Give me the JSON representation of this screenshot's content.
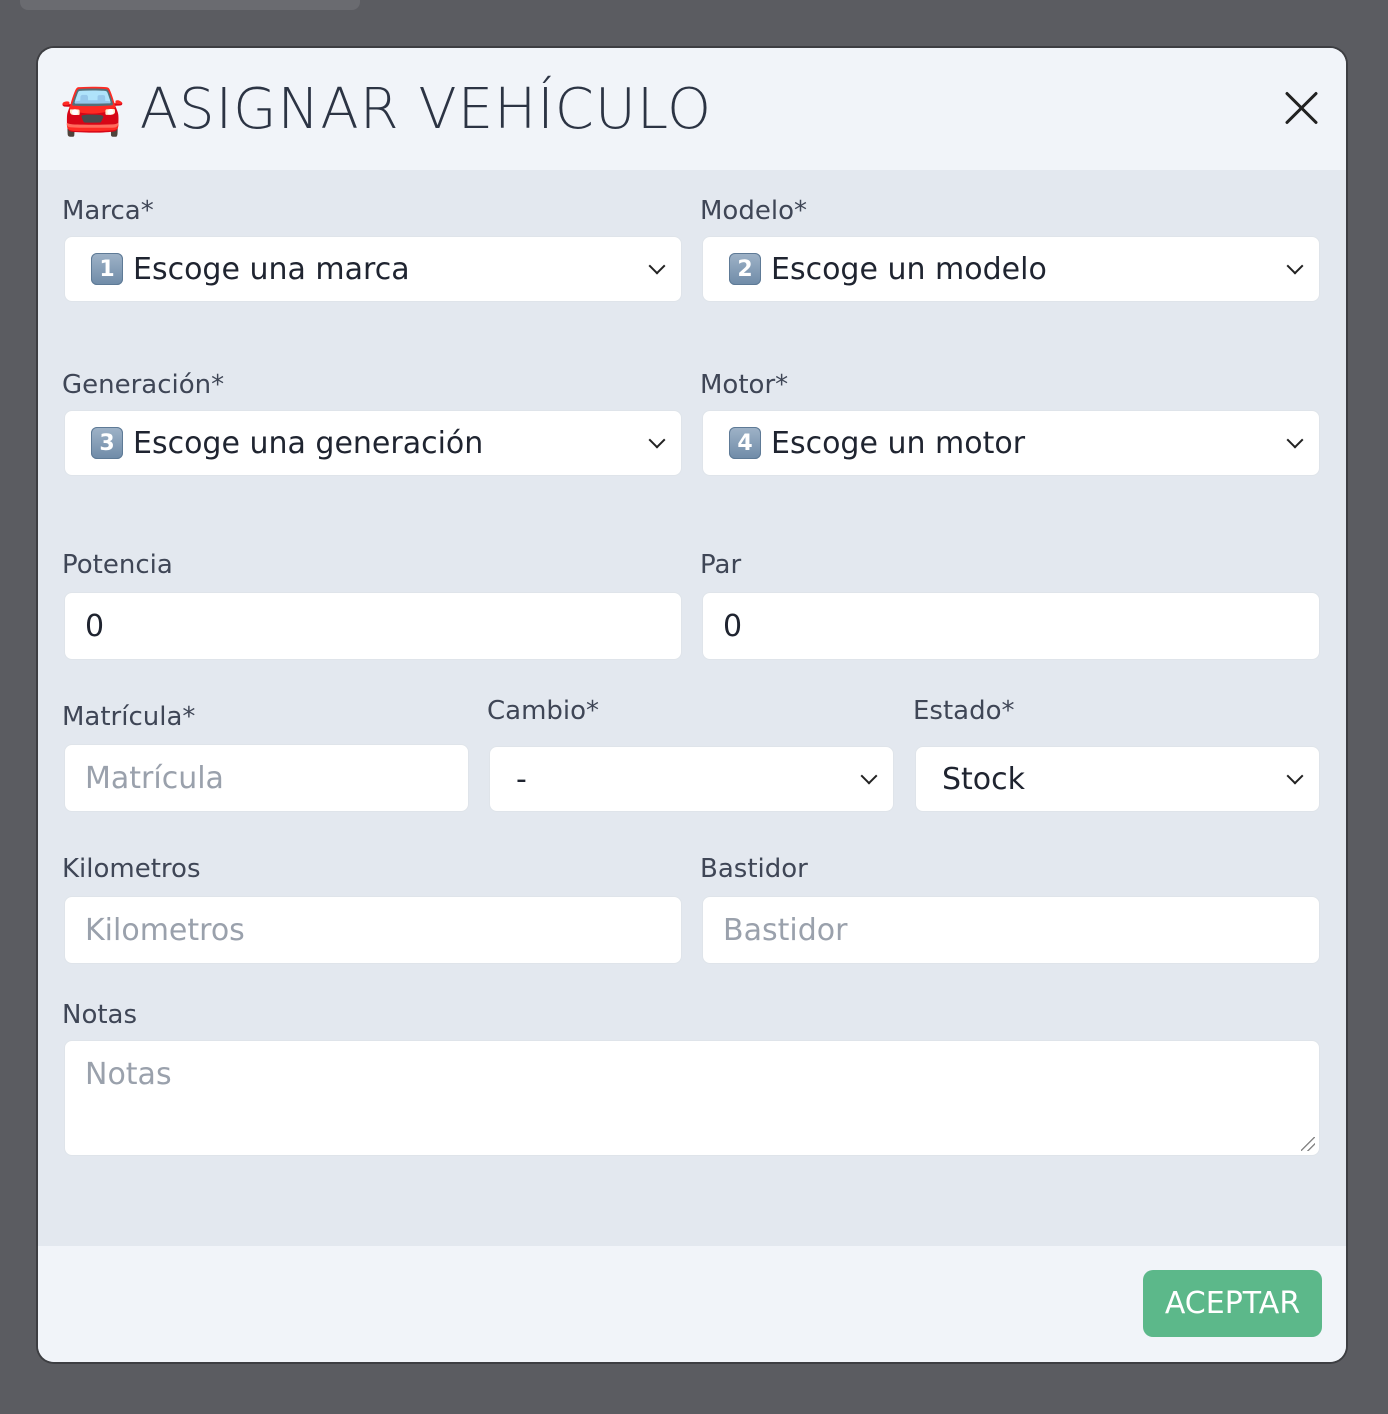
{
  "modal": {
    "title_icon": "🚘",
    "title": "ASIGNAR VEHÍCULO",
    "close_icon": "close-icon"
  },
  "fields": {
    "marca": {
      "label": "Marca*",
      "badge": "1",
      "value": "Escoge una marca"
    },
    "modelo": {
      "label": "Modelo*",
      "badge": "2",
      "value": "Escoge un modelo"
    },
    "generacion": {
      "label": "Generación*",
      "badge": "3",
      "value": "Escoge una generación"
    },
    "motor": {
      "label": "Motor*",
      "badge": "4",
      "value": "Escoge un motor"
    },
    "potencia": {
      "label": "Potencia",
      "value": "0"
    },
    "par": {
      "label": "Par",
      "value": "0"
    },
    "matricula": {
      "label": "Matrícula*",
      "placeholder": "Matrícula"
    },
    "cambio": {
      "label": "Cambio*",
      "value": "-"
    },
    "estado": {
      "label": "Estado*",
      "value": "Stock"
    },
    "kilometros": {
      "label": "Kilometros",
      "placeholder": "Kilometros"
    },
    "bastidor": {
      "label": "Bastidor",
      "placeholder": "Bastidor"
    },
    "notas": {
      "label": "Notas",
      "placeholder": "Notas"
    }
  },
  "footer": {
    "accept_label": "ACEPTAR",
    "accept_color": "#5cb88a"
  }
}
